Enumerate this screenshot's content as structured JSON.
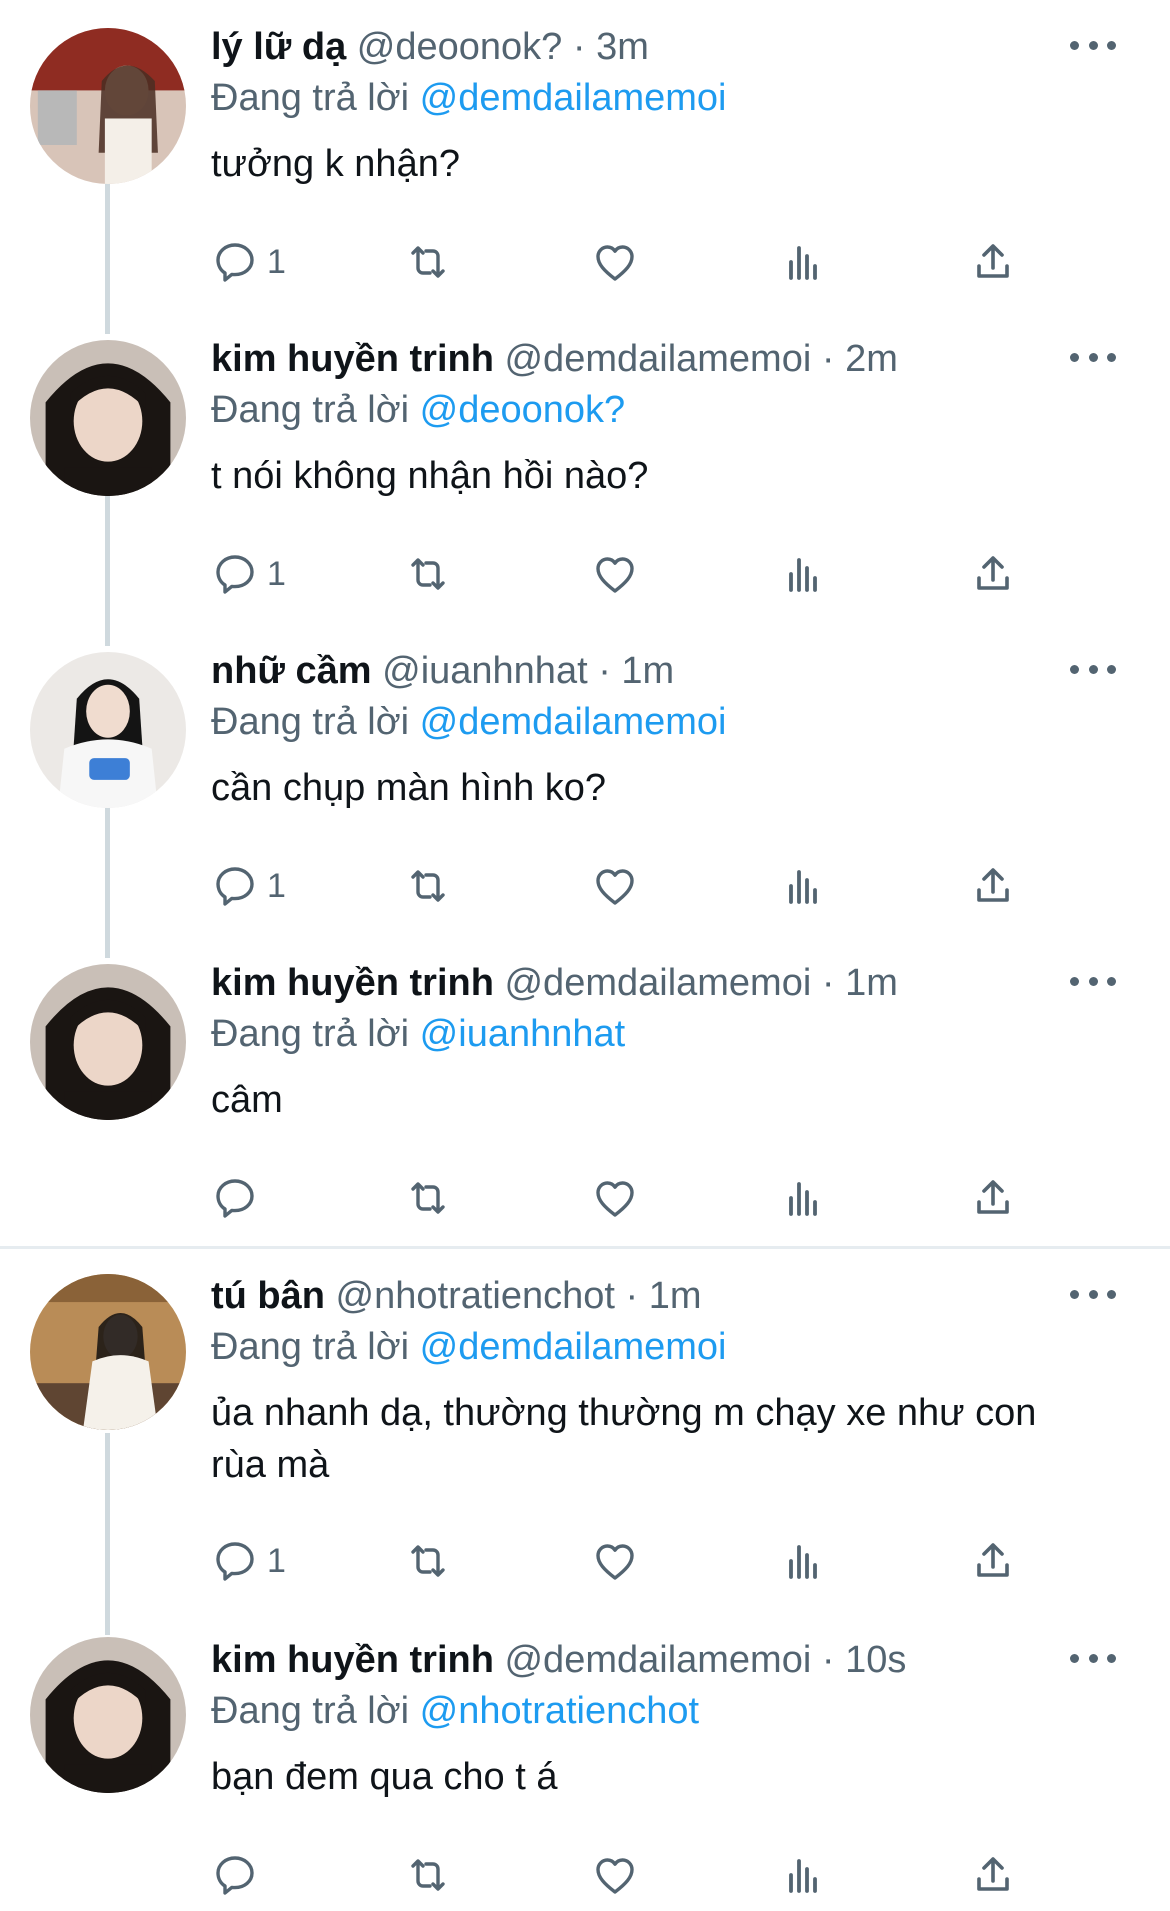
{
  "reply_prefix": "Đang trả lời",
  "colors": {
    "accent": "#1d9bf0",
    "muted": "#536471",
    "text": "#0f1419",
    "thread_line": "#cfd9de"
  },
  "icons": {
    "reply": "reply-icon",
    "retweet": "retweet-icon",
    "like": "heart-icon",
    "views": "views-icon",
    "share": "share-icon",
    "more": "more-options-icon"
  },
  "tweets": [
    {
      "name": "lý lữ dạ",
      "handle": "@deoonok?",
      "time": "· 3m",
      "reply_to": "@demdailamemoi",
      "text": "tưởng k nhận?",
      "reply_count": "1"
    },
    {
      "name": "kim huyền trinh",
      "handle": "@demdailamemoi",
      "time": "· 2m",
      "reply_to": "@deoonok?",
      "text": "t nói không nhận hồi nào?",
      "reply_count": "1"
    },
    {
      "name": "nhữ cầm",
      "handle": "@iuanhnhat",
      "time": "· 1m",
      "reply_to": "@demdailamemoi",
      "text": "cần chụp màn hình ko?",
      "reply_count": "1"
    },
    {
      "name": "kim huyền trinh",
      "handle": "@demdailamemoi",
      "time": "· 1m",
      "reply_to": "@iuanhnhat",
      "text": "câm",
      "reply_count": ""
    },
    {
      "name": "tú bân",
      "handle": "@nhotratienchot",
      "time": "· 1m",
      "reply_to": "@demdailamemoi",
      "text": "ủa nhanh dạ, thường thường m chạy xe như con rùa mà",
      "reply_count": "1"
    },
    {
      "name": "kim huyền trinh",
      "handle": "@demdailamemoi",
      "time": "· 10s",
      "reply_to": "@nhotratienchot",
      "text": "bạn đem qua cho t á",
      "reply_count": ""
    }
  ]
}
